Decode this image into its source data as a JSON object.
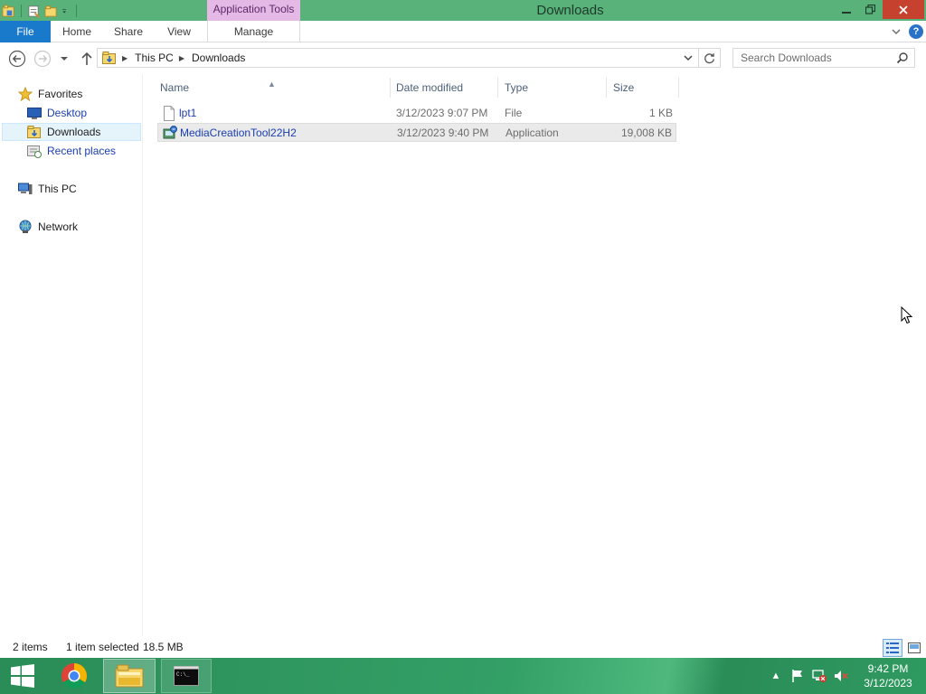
{
  "window": {
    "title": "Downloads",
    "context_tab_header": "Application Tools"
  },
  "ribbon": {
    "tabs": {
      "file": "File",
      "home": "Home",
      "share": "Share",
      "view": "View",
      "manage": "Manage"
    },
    "help": "?"
  },
  "navigation": {
    "breadcrumb": [
      "This PC",
      "Downloads"
    ],
    "search_placeholder": "Search Downloads"
  },
  "nav_pane": {
    "favorites": "Favorites",
    "desktop": "Desktop",
    "downloads": "Downloads",
    "recent_places": "Recent places",
    "this_pc": "This PC",
    "network": "Network"
  },
  "columns": {
    "name": "Name",
    "date": "Date modified",
    "type": "Type",
    "size": "Size"
  },
  "files": [
    {
      "name": "lpt1",
      "date": "3/12/2023 9:07 PM",
      "type": "File",
      "size": "1 KB",
      "icon": "blank-file-icon",
      "selected": false
    },
    {
      "name": "MediaCreationTool22H2",
      "date": "3/12/2023 9:40 PM",
      "type": "Application",
      "size": "19,008 KB",
      "icon": "setup-app-icon",
      "selected": true
    }
  ],
  "status": {
    "item_count": "2 items",
    "selected": "1 item selected",
    "selected_size": "18.5 MB"
  },
  "taskbar": {
    "time": "9:42 PM",
    "date": "3/12/2023"
  },
  "colors": {
    "titlebar": "#58b27a",
    "file_tab": "#1979ca",
    "context_tab": "#e5b9e5",
    "close_button": "#c7412f",
    "link_text": "#1a3eb0"
  }
}
